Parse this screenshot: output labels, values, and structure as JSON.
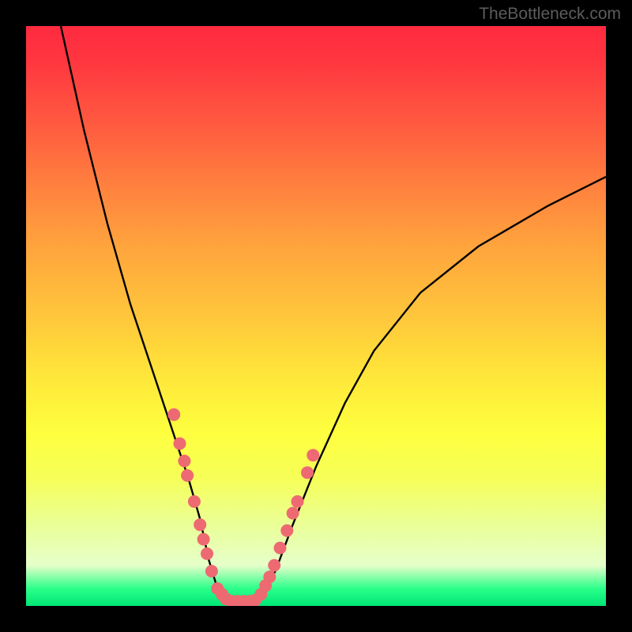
{
  "watermark": "TheBottleneck.com",
  "chart_data": {
    "type": "line",
    "title": "",
    "xlabel": "",
    "ylabel": "",
    "xlim": [
      0,
      100
    ],
    "ylim": [
      0,
      100
    ],
    "grid": false,
    "series": [
      {
        "name": "curve",
        "x": [
          6,
          10,
          14,
          18,
          22,
          26,
          28,
          30,
          31.5,
          33,
          35,
          37,
          40,
          43,
          46,
          50,
          55,
          60,
          68,
          78,
          90,
          100
        ],
        "y": [
          100,
          82,
          66,
          52,
          40,
          28,
          22,
          15,
          8,
          3,
          0,
          0,
          1,
          6,
          14,
          24,
          35,
          44,
          54,
          62,
          69,
          74
        ]
      }
    ],
    "markers": [
      {
        "x": 25.5,
        "y": 33
      },
      {
        "x": 26.5,
        "y": 28
      },
      {
        "x": 27.3,
        "y": 25
      },
      {
        "x": 27.8,
        "y": 22.5
      },
      {
        "x": 29.0,
        "y": 18
      },
      {
        "x": 30.0,
        "y": 14
      },
      {
        "x": 30.6,
        "y": 11.5
      },
      {
        "x": 31.2,
        "y": 9
      },
      {
        "x": 32.0,
        "y": 6
      },
      {
        "x": 33.0,
        "y": 3
      },
      {
        "x": 33.8,
        "y": 2
      },
      {
        "x": 34.5,
        "y": 1.2
      },
      {
        "x": 35.5,
        "y": 0.8
      },
      {
        "x": 36.5,
        "y": 0.8
      },
      {
        "x": 37.5,
        "y": 0.8
      },
      {
        "x": 38.5,
        "y": 0.8
      },
      {
        "x": 39.5,
        "y": 1.0
      },
      {
        "x": 40.5,
        "y": 2
      },
      {
        "x": 41.3,
        "y": 3.5
      },
      {
        "x": 42.0,
        "y": 5
      },
      {
        "x": 42.8,
        "y": 7
      },
      {
        "x": 43.8,
        "y": 10
      },
      {
        "x": 45.0,
        "y": 13
      },
      {
        "x": 46.0,
        "y": 16
      },
      {
        "x": 46.8,
        "y": 18
      },
      {
        "x": 48.5,
        "y": 23
      },
      {
        "x": 49.5,
        "y": 26
      }
    ],
    "marker_color": "#ed6a72",
    "marker_radius": 8
  }
}
